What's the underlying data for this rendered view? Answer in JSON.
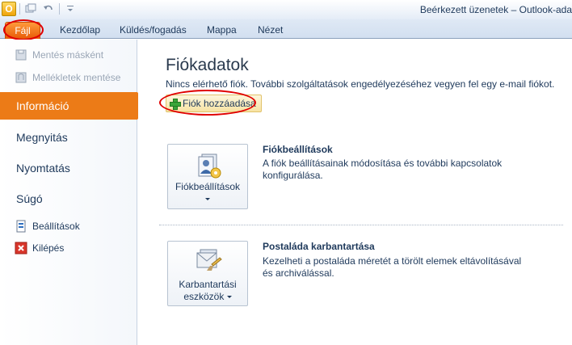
{
  "window": {
    "title": "Beérkezett üzenetek – Outlook-ada"
  },
  "qat": {
    "app_letter": "O"
  },
  "tabs": [
    {
      "label": "Fájl"
    },
    {
      "label": "Kezdőlap"
    },
    {
      "label": "Küldés/fogadás"
    },
    {
      "label": "Mappa"
    },
    {
      "label": "Nézet"
    }
  ],
  "left": {
    "commands_top": [
      {
        "label": "Mentés másként",
        "icon": "save-icon",
        "enabled": false
      },
      {
        "label": "Mellékletek mentése",
        "icon": "attachment-save-icon",
        "enabled": false
      }
    ],
    "nav": [
      {
        "label": "Információ",
        "active": true
      },
      {
        "label": "Megnyitás"
      },
      {
        "label": "Nyomtatás"
      },
      {
        "label": "Súgó"
      }
    ],
    "commands_bottom": [
      {
        "label": "Beállítások",
        "icon": "options-icon"
      },
      {
        "label": "Kilépés",
        "icon": "exit-icon"
      }
    ]
  },
  "main": {
    "title": "Fiókadatok",
    "notice": "Nincs elérhető fiók. További szolgáltatások engedélyezéséhez vegyen fel egy e-mail fiókot.",
    "add_account": "Fiók hozzáadása",
    "sections": [
      {
        "button_label": "Fiókbeállítások",
        "title": "Fiókbeállítások",
        "description": "A fiók beállításainak módosítása és további kapcsolatok konfigurálása."
      },
      {
        "button_label_line1": "Karbantartási",
        "button_label_line2": "eszközök",
        "title": "Postaláda karbantartása",
        "description": "Kezelheti a postaláda méretét a törölt elemek eltávolításával és archiválással."
      }
    ]
  },
  "colors": {
    "file_tab": "#e75b07",
    "active_nav": "#ec7b17",
    "highlight_ring": "#e00000"
  }
}
